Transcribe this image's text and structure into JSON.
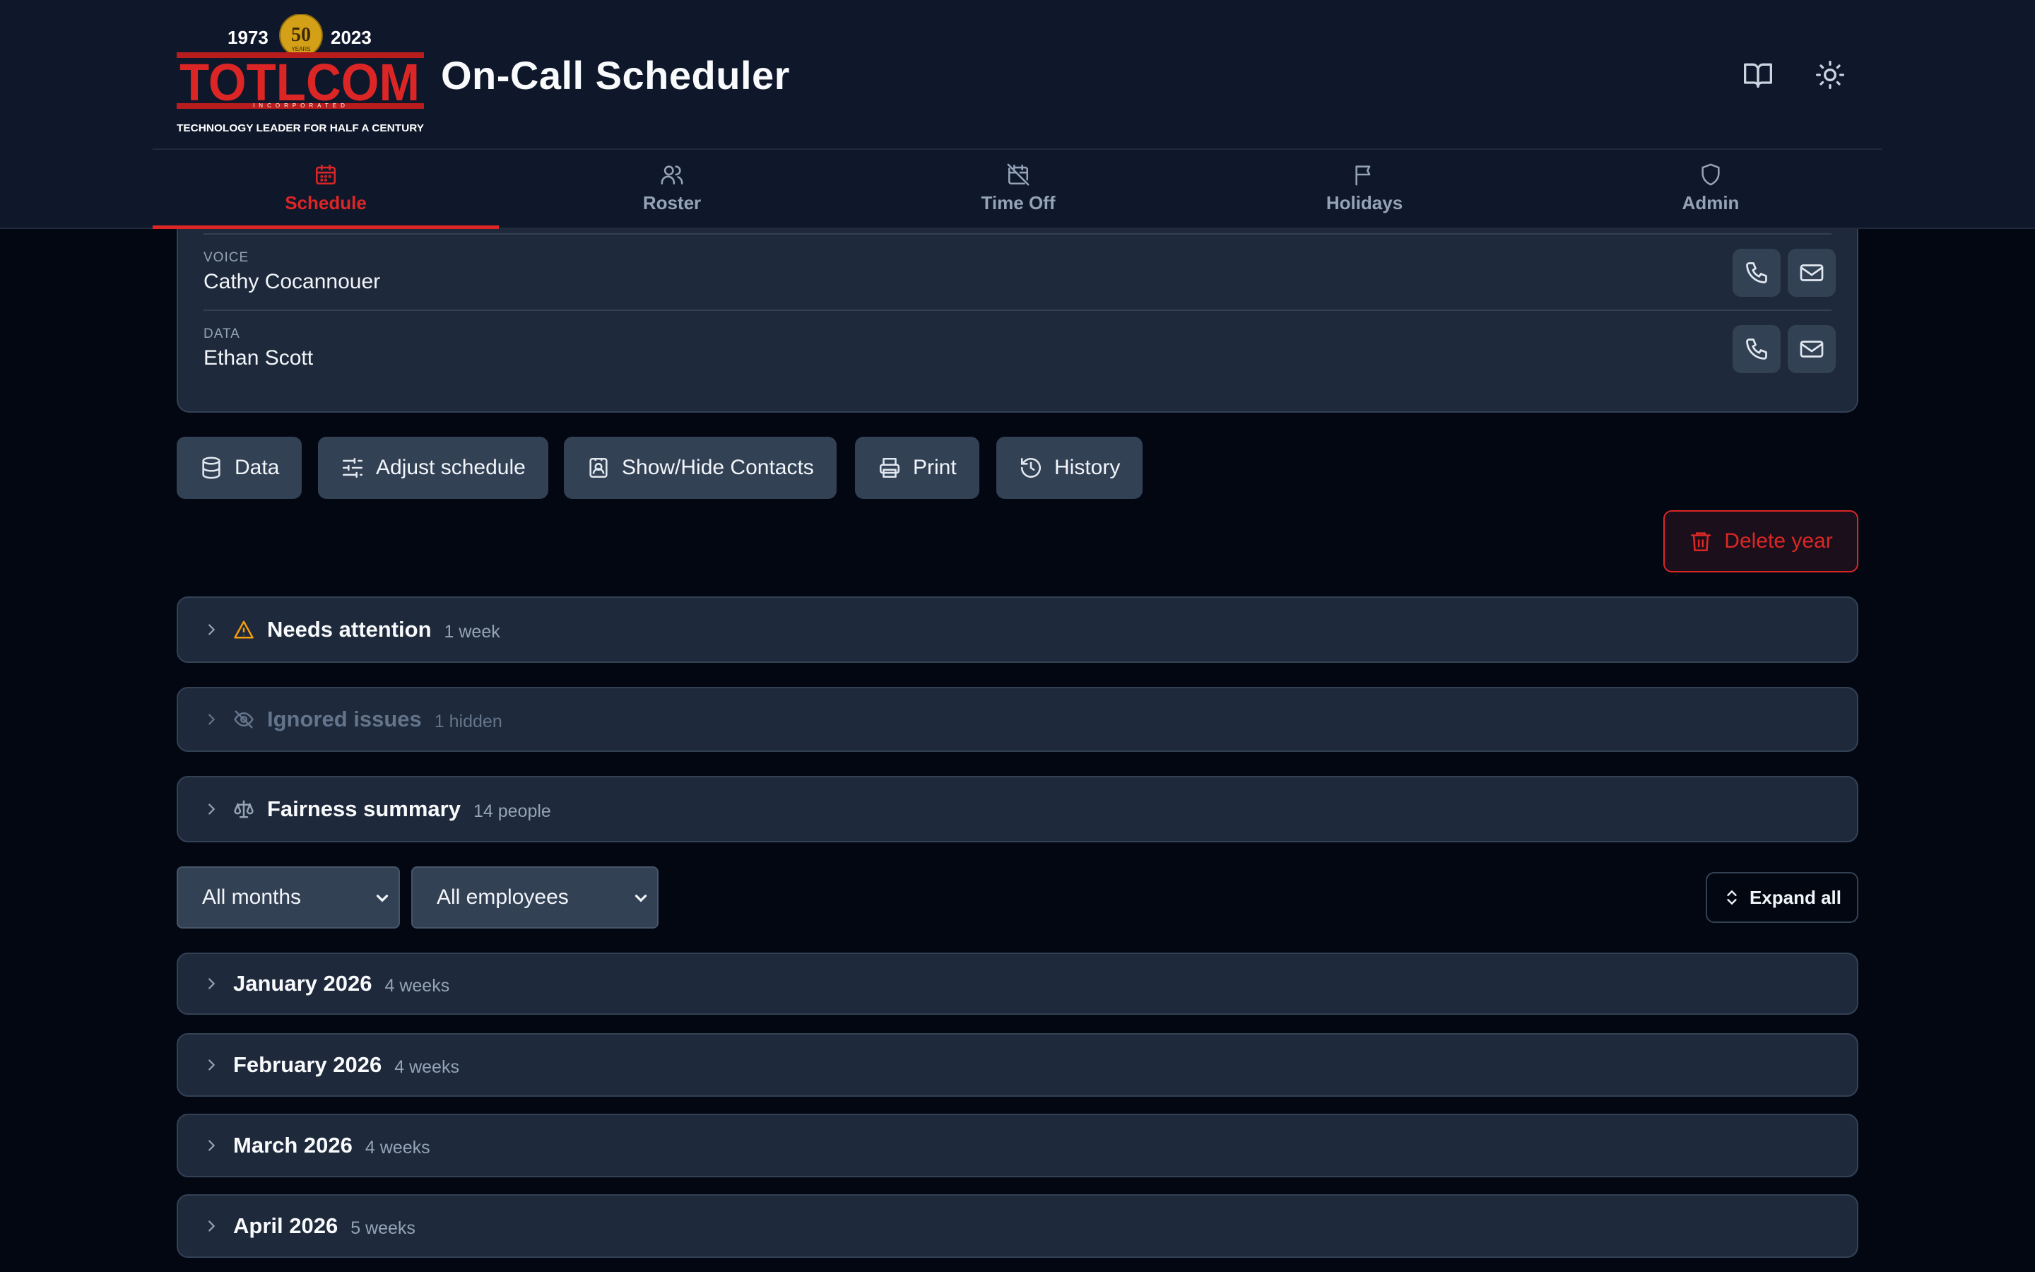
{
  "header": {
    "logo": {
      "year_start": "1973",
      "year_end": "2023",
      "badge": "50",
      "badge_sub": "YEARS",
      "brand": "TOTLCOM",
      "brand_sub": "INCORPORATED",
      "tagline": "TECHNOLOGY LEADER FOR HALF A CENTURY"
    },
    "title": "On-Call Scheduler",
    "icons": [
      "book-icon",
      "sun-icon"
    ]
  },
  "tabs": [
    {
      "label": "Schedule",
      "icon": "calendar-icon",
      "active": true
    },
    {
      "label": "Roster",
      "icon": "users-icon",
      "active": false
    },
    {
      "label": "Time Off",
      "icon": "calendar-off-icon",
      "active": false
    },
    {
      "label": "Holidays",
      "icon": "flag-icon",
      "active": false
    },
    {
      "label": "Admin",
      "icon": "shield-icon",
      "active": false
    }
  ],
  "contacts": [
    {
      "role": "VOICE",
      "name": "Cathy Cocannouer"
    },
    {
      "role": "DATA",
      "name": "Ethan Scott"
    }
  ],
  "toolbar": {
    "data_label": "Data",
    "adjust_label": "Adjust schedule",
    "contacts_label": "Show/Hide Contacts",
    "print_label": "Print",
    "history_label": "History",
    "delete_label": "Delete year"
  },
  "sections": [
    {
      "title": "Needs attention",
      "meta": "1 week",
      "icon": "warning-icon"
    },
    {
      "title": "Ignored issues",
      "meta": "1 hidden",
      "icon": "eye-off-icon"
    },
    {
      "title": "Fairness summary",
      "meta": "14 people",
      "icon": "scale-icon"
    }
  ],
  "filters": {
    "month": "All months",
    "employee": "All employees",
    "expand_label": "Expand all"
  },
  "months": [
    {
      "title": "January 2026",
      "meta": "4 weeks"
    },
    {
      "title": "February 2026",
      "meta": "4 weeks"
    },
    {
      "title": "March 2026",
      "meta": "4 weeks"
    },
    {
      "title": "April 2026",
      "meta": "5 weeks"
    }
  ],
  "colors": {
    "accent": "#dc2626",
    "background": "#030712",
    "surface": "#1e293b",
    "warning": "#f59e0b"
  }
}
